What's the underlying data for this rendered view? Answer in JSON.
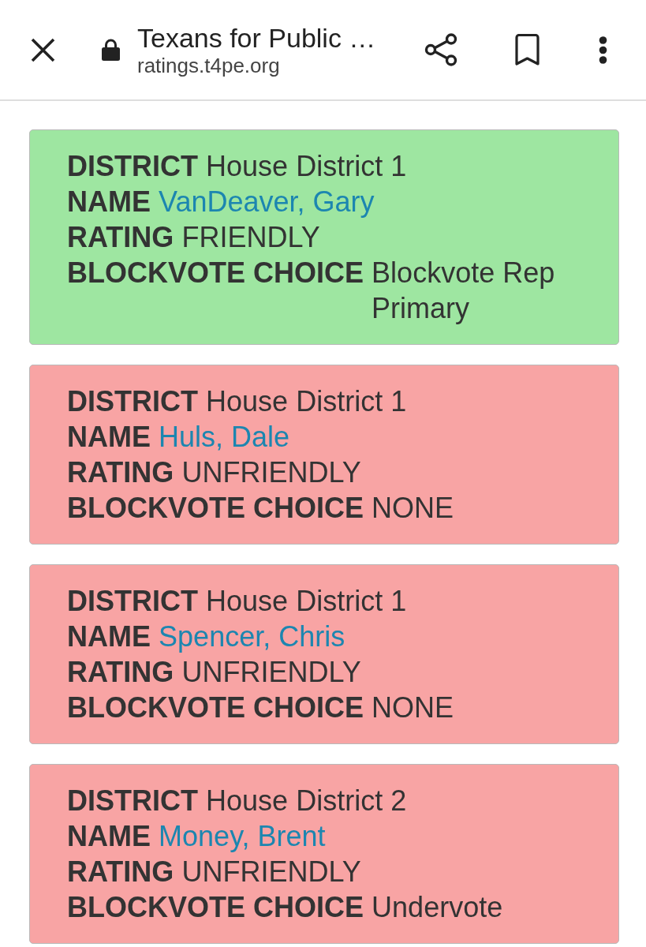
{
  "browser_bar": {
    "title": "Texans for Public …",
    "url": "ratings.t4pe.org"
  },
  "cards": [
    {
      "color": "#9ee6a1",
      "fields": [
        {
          "kind": "text",
          "label": "DISTRICT",
          "value": "House District 1"
        },
        {
          "kind": "link",
          "label": "NAME",
          "value": "VanDeaver, Gary"
        },
        {
          "kind": "text",
          "label": "RATING",
          "value": "FRIENDLY"
        },
        {
          "kind": "text",
          "label": "BLOCKVOTE CHOICE",
          "value": "Blockvote Rep Primary"
        }
      ]
    },
    {
      "color": "#f8a4a4",
      "fields": [
        {
          "kind": "text",
          "label": "DISTRICT",
          "value": "House District 1"
        },
        {
          "kind": "link",
          "label": "NAME",
          "value": "Huls, Dale"
        },
        {
          "kind": "text",
          "label": "RATING",
          "value": "UNFRIENDLY"
        },
        {
          "kind": "text",
          "label": "BLOCKVOTE CHOICE",
          "value": "NONE"
        }
      ]
    },
    {
      "color": "#f8a4a4",
      "fields": [
        {
          "kind": "text",
          "label": "DISTRICT",
          "value": "House District 1"
        },
        {
          "kind": "link",
          "label": "NAME",
          "value": "Spencer, Chris"
        },
        {
          "kind": "text",
          "label": "RATING",
          "value": "UNFRIENDLY"
        },
        {
          "kind": "text",
          "label": "BLOCKVOTE CHOICE",
          "value": "NONE"
        }
      ]
    },
    {
      "color": "#f8a4a4",
      "fields": [
        {
          "kind": "text",
          "label": "DISTRICT",
          "value": "House District 2"
        },
        {
          "kind": "link",
          "label": "NAME",
          "value": "Money, Brent"
        },
        {
          "kind": "text",
          "label": "RATING",
          "value": "UNFRIENDLY"
        },
        {
          "kind": "text",
          "label": "BLOCKVOTE CHOICE",
          "value": "Undervote"
        }
      ]
    }
  ]
}
